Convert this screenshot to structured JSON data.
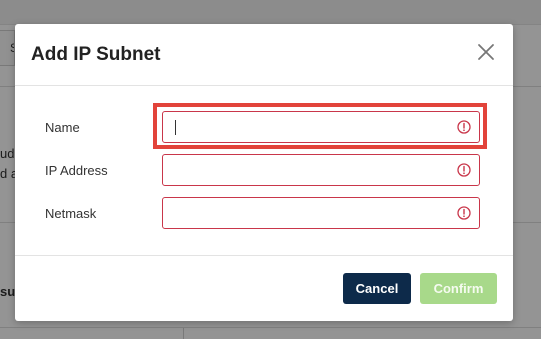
{
  "background": {
    "tab_label": "S",
    "snippet_1": "ud",
    "snippet_2": "d a",
    "snippet_3": "su"
  },
  "modal": {
    "title": "Add IP Subnet",
    "fields": [
      {
        "label": "Name",
        "value": "",
        "placeholder": ""
      },
      {
        "label": "IP Address",
        "value": "",
        "placeholder": ""
      },
      {
        "label": "Netmask",
        "value": "",
        "placeholder": ""
      }
    ],
    "cancel_label": "Cancel",
    "confirm_label": "Confirm"
  },
  "colors": {
    "error": "#c9364a",
    "highlight": "#e2433a",
    "cancel_bg": "#0d2a4a",
    "confirm_bg_disabled": "#a8d98a"
  },
  "icons": {
    "close": "close-icon",
    "field_error": "error-circle-icon"
  }
}
